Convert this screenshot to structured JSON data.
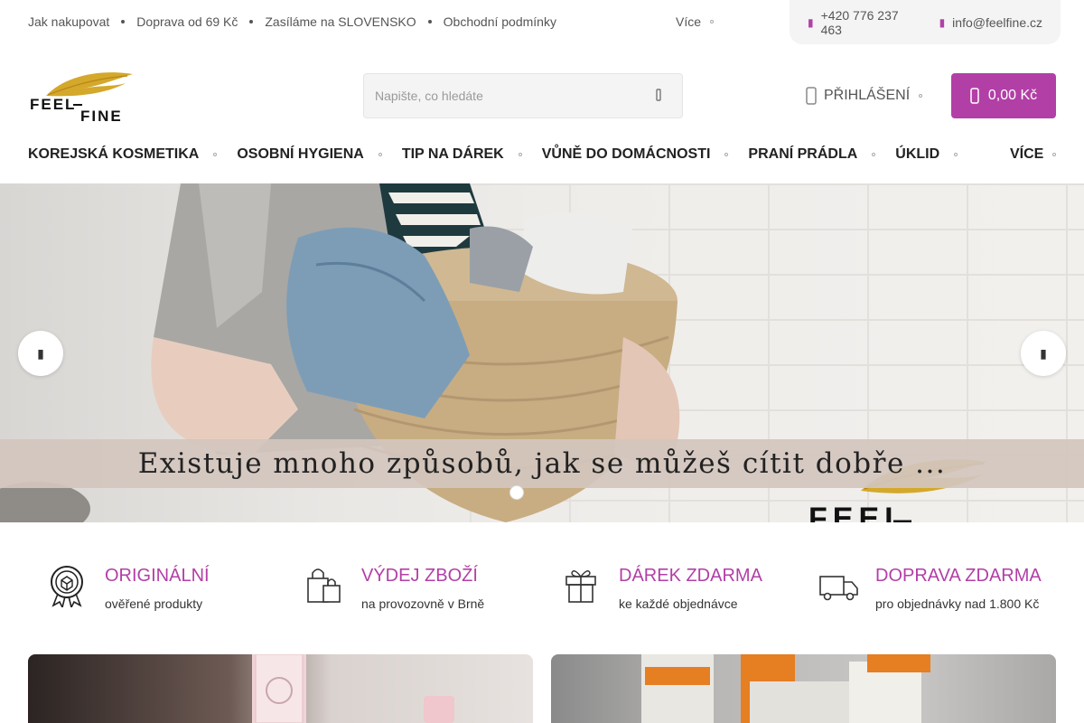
{
  "topbar": {
    "links": [
      "Jak nakupovat",
      "Doprava od 69 Kč",
      "Zasíláme na SLOVENSKO",
      "Obchodní podmínky"
    ],
    "more_label": "Více",
    "phone": "+420 776 237 463",
    "email": "info@feelfine.cz"
  },
  "header": {
    "logo_alt": "FEEL FINE",
    "search_placeholder": "Napište, co hledáte",
    "login_label": "PŘIHLÁŠENÍ",
    "cart_total": "0,00 Kč"
  },
  "nav": {
    "items": [
      "KOREJSKÁ KOSMETIKA",
      "OSOBNÍ HYGIENA",
      "TIP NA DÁREK",
      "VŮNĚ DO DOMÁCNOSTI",
      "PRANÍ PRÁDLA",
      "ÚKLID"
    ],
    "more_label": "VÍCE"
  },
  "hero": {
    "caption": "Existuje mnoho způsobů, jak se můžeš cítit dobře ...",
    "slide_count": 1,
    "active_slide": 1
  },
  "benefits": [
    {
      "title": "ORIGINÁLNÍ",
      "subtitle": "ověřené produkty",
      "icon": "certified-badge-icon"
    },
    {
      "title": "VÝDEJ ZBOŽÍ",
      "subtitle": "na provozovně v Brně",
      "icon": "shopping-bags-icon"
    },
    {
      "title": "DÁREK ZDARMA",
      "subtitle": "ke každé objednávce",
      "icon": "gift-icon"
    },
    {
      "title": "DOPRAVA ZDARMA",
      "subtitle": "pro objednávky nad 1.800 Kč",
      "icon": "truck-icon"
    }
  ],
  "colors": {
    "accent": "#b23fa6",
    "gold": "#d4a82a",
    "band": "#d3c6be"
  }
}
